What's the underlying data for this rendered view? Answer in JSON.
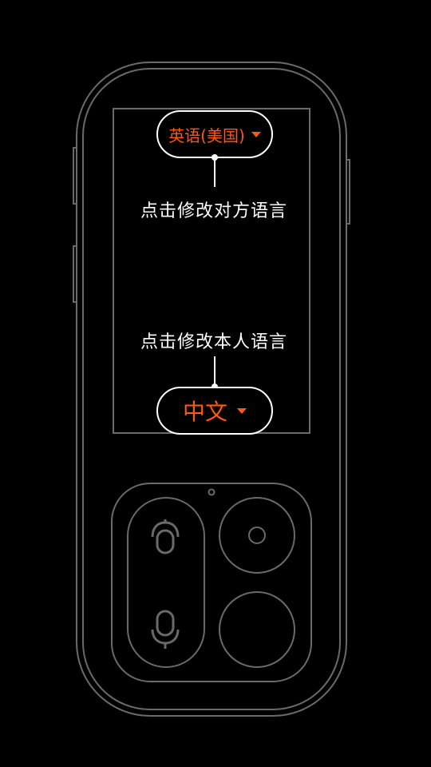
{
  "colors": {
    "accent": "#ff5a14",
    "background": "#000000",
    "outline": "#6a6a6a",
    "text": "#ffffff"
  },
  "remote_language": {
    "label": "英语(美国)",
    "hint": "点击修改对方语言",
    "icon": "caret-down-icon"
  },
  "own_language": {
    "label": "中文",
    "hint": "点击修改本人语言",
    "icon": "caret-down-icon"
  },
  "device": {
    "buttons": [
      {
        "name": "translate-remote-button",
        "icon": "hand-mic-icon"
      },
      {
        "name": "record-own-button",
        "icon": "microphone-icon"
      },
      {
        "name": "round-button-top",
        "icon": "circle-icon"
      },
      {
        "name": "round-button-bottom",
        "icon": ""
      }
    ]
  }
}
